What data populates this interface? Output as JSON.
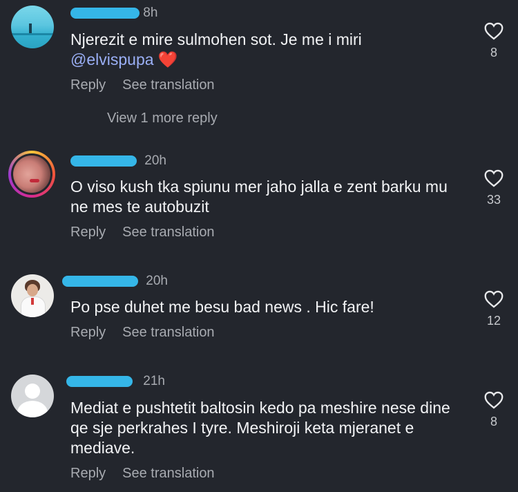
{
  "colors": {
    "background": "#23262d",
    "mention": "#9aaff5",
    "redaction": "#35b6e8"
  },
  "comments": [
    {
      "username_fragment": "8h",
      "time": "",
      "text": "Njerezit e mire sulmohen sot. Je me i miri",
      "mention": "@elvispupa",
      "emoji": "❤️",
      "likes": "8",
      "reply_label": "Reply",
      "translate_label": "See translation",
      "view_more": "View 1 more reply"
    },
    {
      "username_fragment": "",
      "time": "20h",
      "text": "O viso kush tka spiunu mer jaho jalla e zent barku mu ne mes te autobuzit",
      "likes": "33",
      "reply_label": "Reply",
      "translate_label": "See translation"
    },
    {
      "username_fragment": "",
      "time": "20h",
      "text": "Po pse duhet me besu bad news . Hic fare!",
      "likes": "12",
      "reply_label": "Reply",
      "translate_label": "See translation"
    },
    {
      "username_fragment": "",
      "time": "21h",
      "text": "Mediat e pushtetit baltosin kedo pa meshire nese dine qe sje perkrahes I tyre. Meshiroji keta mjeranet e mediave.",
      "likes": "8",
      "reply_label": "Reply",
      "translate_label": "See translation"
    }
  ]
}
